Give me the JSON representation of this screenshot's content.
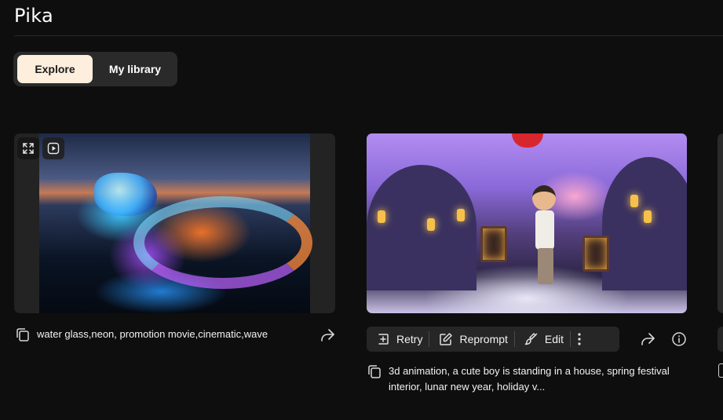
{
  "brand": {
    "name": "Pika"
  },
  "tabs": [
    {
      "label": "Explore",
      "active": true
    },
    {
      "label": "My library",
      "active": false
    }
  ],
  "cards": [
    {
      "prompt": "water glass,neon, promotion movie,cinematic,wave",
      "icons": [
        "expand-icon",
        "play-icon",
        "copy-icon",
        "share-icon"
      ]
    },
    {
      "prompt": "3d animation, a cute boy is standing in a house, spring festival interior, lunar new year, holiday v...",
      "actions": [
        {
          "label": "Retry",
          "icon": "retry-icon"
        },
        {
          "label": "Reprompt",
          "icon": "pencil-icon"
        },
        {
          "label": "Edit",
          "icon": "brush-icon"
        }
      ],
      "icons": [
        "more-icon",
        "copy-icon",
        "share-icon",
        "info-icon"
      ]
    }
  ],
  "colors": {
    "background": "#0e0e0e",
    "active_tab": "#fdeedd",
    "tab_bar": "#2a2a2a",
    "toolbar": "#262626"
  }
}
